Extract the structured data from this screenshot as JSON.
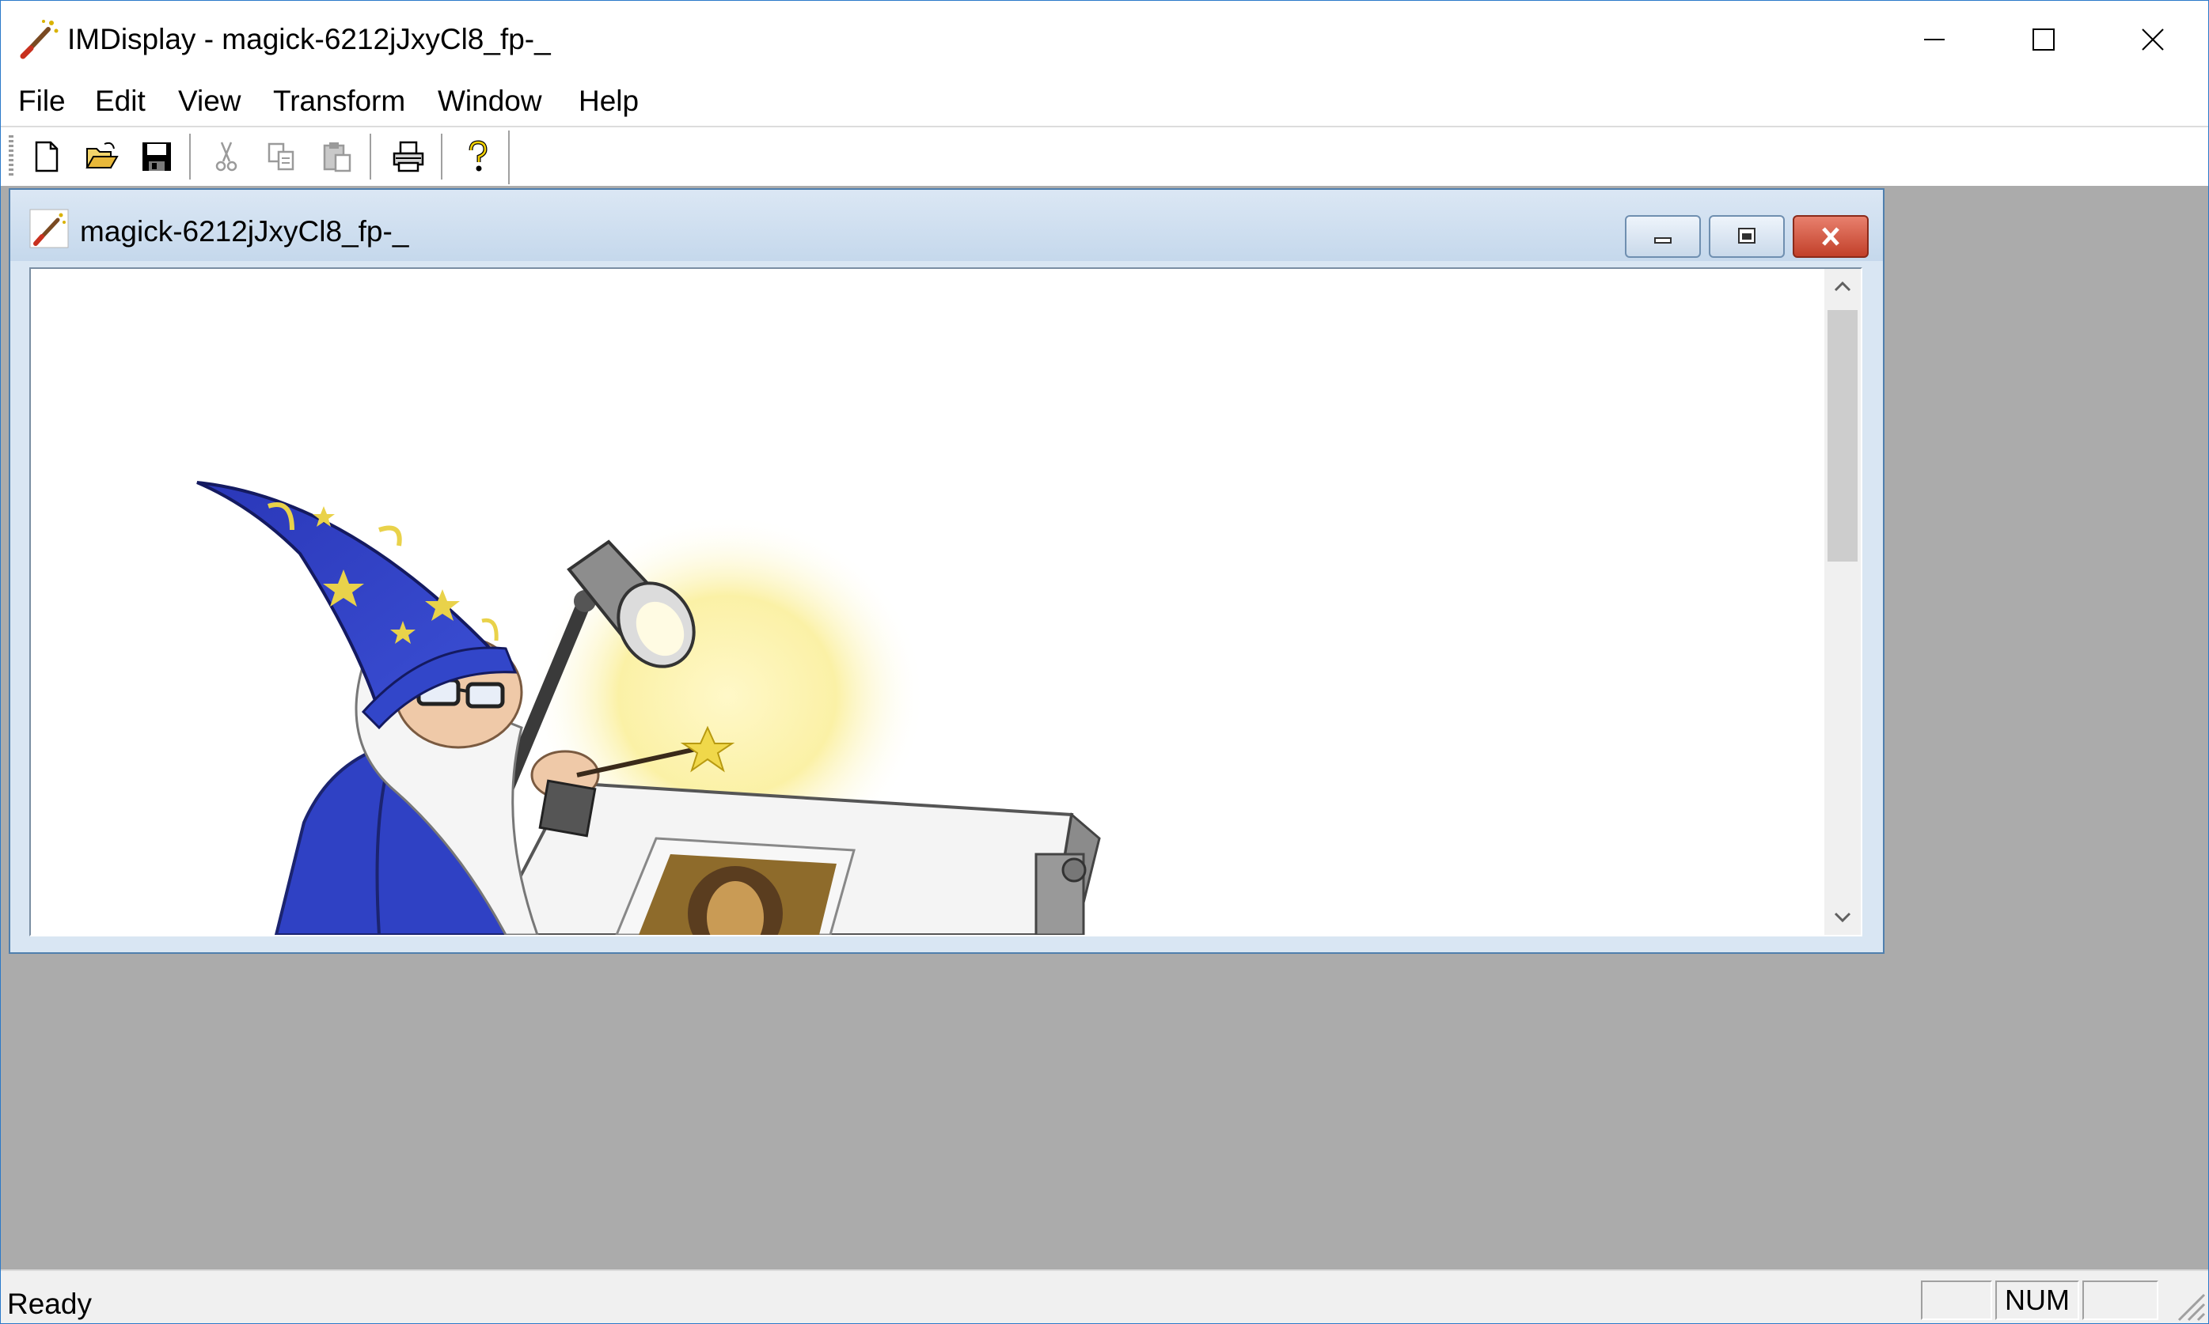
{
  "app": {
    "title": "IMDisplay - magick-6212jJxyCl8_fp-_"
  },
  "window_controls": {
    "minimize_icon": "minimize-icon",
    "maximize_icon": "maximize-icon",
    "close_icon": "close-icon"
  },
  "menu": [
    {
      "label": "File"
    },
    {
      "label": "Edit"
    },
    {
      "label": "View"
    },
    {
      "label": "Transform"
    },
    {
      "label": "Window"
    },
    {
      "label": "Help"
    }
  ],
  "toolbar": {
    "buttons": [
      {
        "icon": "new-file-icon",
        "enabled": true
      },
      {
        "icon": "open-folder-icon",
        "enabled": true
      },
      {
        "icon": "save-disk-icon",
        "enabled": true
      },
      {
        "icon": "cut-scissors-icon",
        "enabled": false
      },
      {
        "icon": "copy-icon",
        "enabled": false
      },
      {
        "icon": "paste-icon",
        "enabled": false
      },
      {
        "icon": "print-icon",
        "enabled": true
      },
      {
        "icon": "help-question-icon",
        "enabled": true
      }
    ]
  },
  "document": {
    "title": "magick-6212jJxyCl8_fp-_",
    "image_description_icon": "imagemagick-wizard-image"
  },
  "status": {
    "text": "Ready",
    "panes": [
      "",
      "NUM",
      ""
    ]
  },
  "colors": {
    "accent_border": "#2b79c9",
    "mdi_background": "#ababab",
    "child_frame": "#d9e6f3",
    "close_button": "#c2402a"
  }
}
